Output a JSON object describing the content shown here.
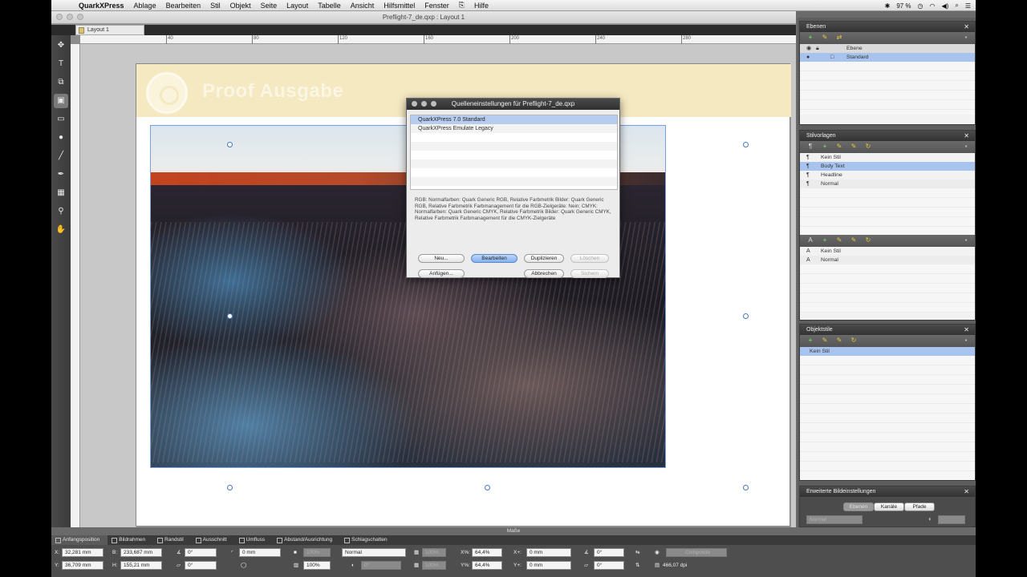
{
  "menubar": {
    "items": [
      "QuarkXPress",
      "Ablage",
      "Bearbeiten",
      "Stil",
      "Objekt",
      "Seite",
      "Layout",
      "Tabelle",
      "Ansicht",
      "Hilfsmittel",
      "Fenster",
      "Hilfe"
    ],
    "battery": "97 %"
  },
  "document": {
    "title": "Preflight-7_de.qxp : Layout 1",
    "tab_label": "Layout 1",
    "ruler_labels": [
      "40",
      "80",
      "120",
      "160",
      "200",
      "240",
      "280"
    ],
    "header_title": "Proof Ausgabe"
  },
  "dialog": {
    "title": "Quelleneinstellungen für Preflight-7_de.qxp",
    "items": [
      "QuarkXPress 7.0 Standard",
      "QuarkXPress Emulate Legacy"
    ],
    "description": "RGB: Normalfarben: Quark Generic RGB, Relative Farbmetrik Bilder: Quark Generic RGB, Relative Farbmetrik Farbmanagement für die RGB-Zielgeräte: Nein; CMYK: Normalfarben: Quark Generic CMYK, Relative Farbmetrik Bilder: Quark Generic CMYK, Relative Farbmetrik Farbmanagement für die CMYK-Zielgeräte",
    "buttons": {
      "new": "Neu...",
      "edit": "Bearbeiten",
      "duplicate": "Duplizieren",
      "delete": "Löschen",
      "append": "Anfügen...",
      "cancel": "Abbrechen",
      "save": "Sichern"
    }
  },
  "palettes": {
    "layers": {
      "title": "Ebenen",
      "column": "Ebene",
      "rows": [
        "Standard"
      ]
    },
    "styles": {
      "title": "Stilvorlagen",
      "paragraph": [
        "Kein Stil",
        "Body Text",
        "Headline",
        "Normal"
      ],
      "character": [
        "Kein Stil",
        "Normal"
      ]
    },
    "object_styles": {
      "title": "Objektstile",
      "rows": [
        "Kein Stil"
      ]
    },
    "image_settings": {
      "title": "Erweiterte Bildeinstellungen",
      "tabs": [
        "Ebenen",
        "Kanäle",
        "Pfade"
      ],
      "dropdown": "Normal"
    }
  },
  "measurements": {
    "title": "Maße",
    "tabs": [
      "Anfangsposition",
      "Bildrahmen",
      "Randstil",
      "Ausschnitt",
      "Umfluss",
      "Abstand/Ausrichtung",
      "Schlagschatten"
    ],
    "x": "32,281 mm",
    "y": "36,709 mm",
    "w": "233,687 mm",
    "h": "155,21 mm",
    "angle1": "0°",
    "angle2": "0°",
    "line_width": "0 mm",
    "pct1": "100%",
    "pct2": "100%",
    "blend": "Normal",
    "xpct": "64,4%",
    "ypct": "64,4%",
    "xplus": "0 mm",
    "yplus": "0 mm",
    "rot1": "0°",
    "rot2": "0°",
    "composite": "Composite",
    "dpi": "466,07 dpi"
  }
}
